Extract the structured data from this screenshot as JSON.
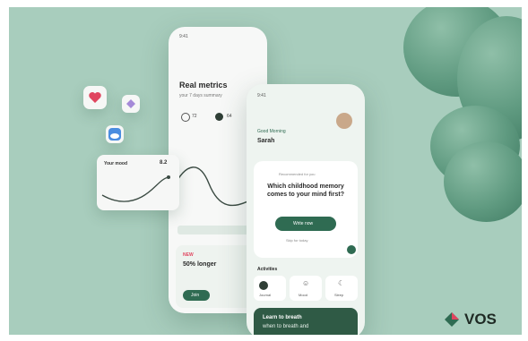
{
  "back_phone": {
    "time": "9:41",
    "title": "Real metrics",
    "subtitle": "your 7 days summary",
    "stat_a": "72",
    "stat_b": "64"
  },
  "mood_card": {
    "label": "Your mood",
    "value": "8.2"
  },
  "front_phone": {
    "time": "9:41",
    "greeting": "Good Morning",
    "name": "Sarah",
    "question_small": "Recommended for you",
    "question": "Which childhood memory comes to your mind first?",
    "cta_label": "Write now",
    "cta_sub": "Skip for today",
    "section_title": "Activities",
    "tile_1": "Journal",
    "tile_2": "Mood",
    "tile_3": "Sleep",
    "banner_line1": "Learn to breath",
    "banner_line2": "when to breath and"
  },
  "back_phone_bottom": {
    "tag": "NEW",
    "title": "50% longer",
    "button": "Join"
  },
  "brand": {
    "logo_text": "VOS"
  },
  "colors": {
    "background": "#a8cdbd",
    "accent": "#2f6b52",
    "heart": "#e0455f",
    "cloud": "#4a8de0"
  }
}
